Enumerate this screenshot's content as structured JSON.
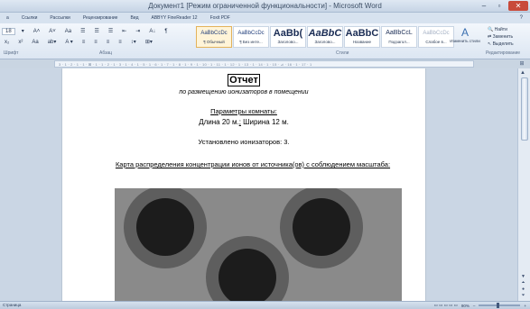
{
  "window": {
    "title": "Документ1 [Режим ограниченной функциональности] - Microsoft Word",
    "minimize": "–",
    "maximize": "▫",
    "close": "✕"
  },
  "ribbon_tabs": [
    "а",
    "Ссылки",
    "Рассылки",
    "Рецензирование",
    "Вид",
    "ABBYY FineReader 12",
    "Foxit PDF"
  ],
  "ribbon": {
    "font_size": "18",
    "row1": [
      "▾",
      "A˄",
      "A˅",
      "Aa",
      "☰",
      "☰",
      "☰",
      "⇤",
      "⇥",
      "A↓",
      "¶"
    ],
    "row2": [
      "x₂",
      "x²",
      "Aa",
      "ab▾",
      "A ▾",
      "≡",
      "≡",
      "≡",
      "≡",
      "↕▾",
      "⊞▾"
    ],
    "groups": {
      "font": "Шрифт",
      "paragraph": "Абзац",
      "styles": "Стили",
      "editing": "Редактирование"
    },
    "styles": [
      {
        "sample": "AaBbCcDc",
        "name": "¶ Обычный",
        "cls": "",
        "selected": true
      },
      {
        "sample": "AaBbCcDc",
        "name": "¶ Без инте...",
        "cls": "",
        "selected": false
      },
      {
        "sample": "AaBb(",
        "name": "Заголово...",
        "cls": "big",
        "selected": false
      },
      {
        "sample": "AaBbC",
        "name": "Заголово...",
        "cls": "bigi",
        "selected": false
      },
      {
        "sample": "AaBbC",
        "name": "Название",
        "cls": "big",
        "selected": false
      },
      {
        "sample": "AaBbCcL",
        "name": "Подзагол...",
        "cls": "mid",
        "selected": false
      },
      {
        "sample": "AaBbCcDc",
        "name": "Слабое в...",
        "cls": "light",
        "selected": false
      }
    ],
    "change_styles": {
      "icon": "A",
      "label": "Изменить стили"
    },
    "editing": {
      "find": "Найти",
      "replace": "Заменить",
      "select": "Выделить"
    }
  },
  "ruler": {
    "text": "3 · 1 · 2 · 1 · 1 · ⊠ · 1 · 1 · 2 · 1 · 3 · 1 · 4 · 1 · 5 · 1 · 6 · 1 · 7 · 1 · 8 · 1 · 9 · 1 · 10 · 1 · 11 · 1 · 12 · 1 · 13 · 1 · 14 · 1 · 15 · ⊿ · 16 · 1 · 17 · 1",
    "right_icon": "⊞"
  },
  "document": {
    "title": "Отчет",
    "subtitle": "по размещению ионизаторов в помещении",
    "params_heading": "Параметры комнаты:",
    "length_label": "Длина 20 м.",
    "separator": ";",
    "width_label": "Ширина 12 м.",
    "installed": "Установлено ионизаторов: 3.",
    "map_title": "Карта распределения концентрации ионов от источника(ов) с соблюдением масштаба:"
  },
  "colors": {
    "figure_bg": "#8a8a8a",
    "outer_ring": "#5e5e5e",
    "inner_core": "#1c1c1c"
  },
  "statusbar": {
    "left": "Страница",
    "zoom": "90%"
  }
}
